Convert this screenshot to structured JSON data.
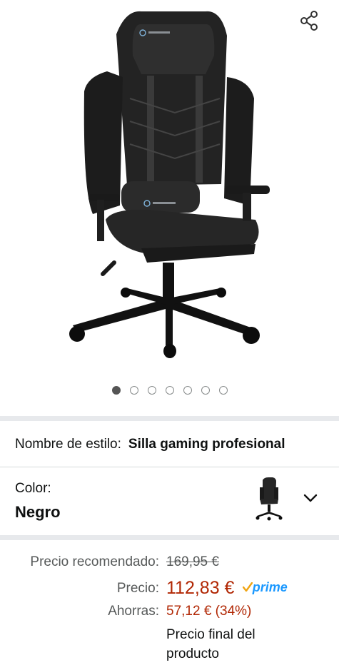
{
  "gallery": {
    "image_alt": "Silla gaming negra",
    "dots_total": 7,
    "dots_active_index": 0
  },
  "style": {
    "label": "Nombre de estilo:",
    "value": "Silla gaming profesional"
  },
  "color": {
    "label": "Color:",
    "value": "Negro"
  },
  "price": {
    "recommended_label": "Precio recomendado:",
    "recommended_value": "169,95 €",
    "price_label": "Precio:",
    "price_value": "112,83 €",
    "prime_label": "prime",
    "savings_label": "Ahorras:",
    "savings_value": "57,12 € (34%)",
    "final_note": "Precio final del producto"
  },
  "colors": {
    "price_red": "#b12704",
    "prime_blue": "#1a98ff",
    "separator": "#e7e9ec",
    "chair_dark": "#262626"
  },
  "icons": {
    "share": "share-icon",
    "chevron": "chevron-down-icon"
  }
}
